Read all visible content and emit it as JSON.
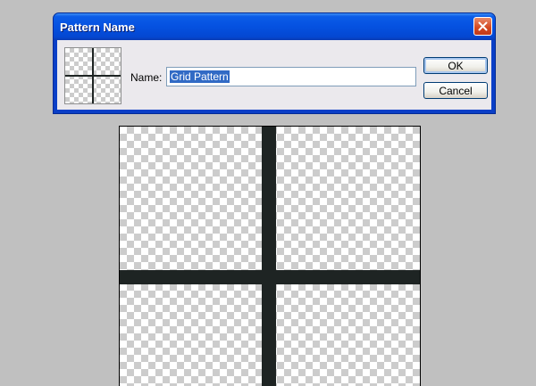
{
  "dialog": {
    "title": "Pattern Name",
    "name_label": "Name:",
    "name_value": "Grid Pattern",
    "ok_label": "OK",
    "cancel_label": "Cancel"
  },
  "icons": {
    "close": "close-icon",
    "thumbnail": "grid-pattern-thumbnail"
  },
  "colors": {
    "titlebar": "#0551e0",
    "selection": "#316ac5",
    "grid_line": "#1e2423",
    "background": "#c0c0c0"
  }
}
